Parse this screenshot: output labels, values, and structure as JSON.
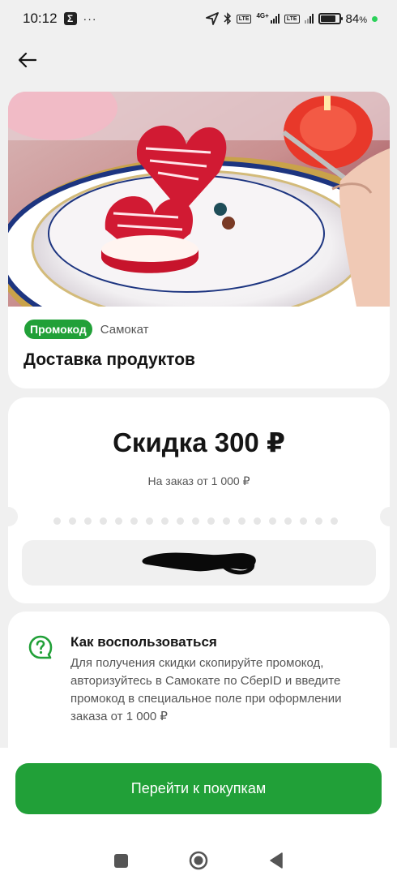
{
  "status_bar": {
    "time": "10:12",
    "overflow": "···",
    "network": "4G+",
    "lte1": "LTE",
    "lte2": "LTE",
    "battery": "84",
    "battery_unit": "%",
    "battery_level": 0.84
  },
  "icons": {
    "back": "arrow-left-icon",
    "help": "question-bubble-icon",
    "location": "location-arrow-icon",
    "bluetooth": "bluetooth-icon"
  },
  "hero": {
    "badge": "Промокод",
    "brand": "Самокат",
    "title": "Доставка продуктов"
  },
  "discount": {
    "title": "Скидка 300 ₽",
    "subtitle": "На заказ от 1 000 ₽"
  },
  "howto": {
    "title": "Как воспользоваться",
    "text": "Для получения скидки скопируйте промокод, авторизуйтесь в Самокате по СберID и введите промокод в специальное поле при оформлении заказа от 1 000 ₽"
  },
  "cta": {
    "label": "Перейти к покупкам"
  },
  "colors": {
    "accent": "#21a038",
    "background": "#f0f0f0",
    "card": "#ffffff"
  }
}
